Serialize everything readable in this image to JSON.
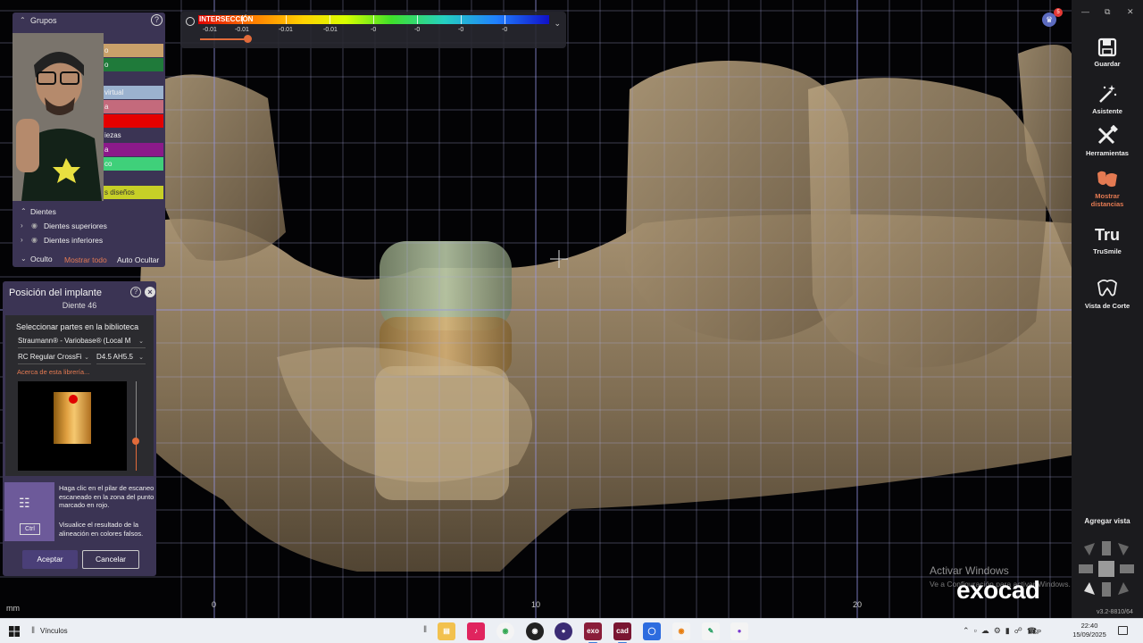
{
  "intersection": {
    "title": "INTERSECCIÓN",
    "values": [
      "-0.01",
      "-0.01",
      "-0.01",
      "-0.01",
      "-0",
      "-0",
      "-0",
      "-0"
    ]
  },
  "groups": {
    "title": "Grupos",
    "help": "?",
    "items": [
      {
        "label": "o",
        "color": "#c9a06a"
      },
      {
        "label": "o",
        "color": "#1f7a3a"
      },
      {
        "label": "virtual",
        "color": "#9bb2cf"
      },
      {
        "label": "a",
        "color": "#c46a7c"
      },
      {
        "label": "",
        "color": "#e50000"
      },
      {
        "label": "iezas",
        "color": "#3b3454"
      },
      {
        "label": "a",
        "color": "#8c1a8a"
      },
      {
        "label": "co",
        "color": "#3fd07a"
      },
      {
        "label": "s diseños",
        "color": "#c7cf27"
      }
    ],
    "teeth_section": "Dientes",
    "upper_teeth": "Dientes superiores",
    "lower_teeth": "Dientes inferiores",
    "hidden_section": "Oculto",
    "show_all": "Mostrar todo",
    "auto_hide": "Auto Ocultar"
  },
  "implant": {
    "title": "Posición del implante",
    "tooth": "Diente 46",
    "library_label": "Seleccionar partes en la biblioteca",
    "library_value": "Straumann® - Variobase® (Local M",
    "connection_value": "RC Regular CrossFi",
    "size_value": "D4.5 AH5.5",
    "about_library": "Acerca de esta librería...",
    "ctrl_key": "Ctrl",
    "hint_1": "Haga clic en el pilar de escaneo escaneado en la zona del punto marcado en rojo.",
    "hint_2": "Visualice el resultado de la alineación en colores falsos.",
    "accept": "Aceptar",
    "cancel": "Cancelar",
    "slider_level": 0.33
  },
  "toolbar": {
    "save": "Guardar",
    "assistant": "Asistente",
    "tools": "Herramientas",
    "distances_1": "Mostrar",
    "distances_2": "distancias",
    "trusmile_icon": "Tru",
    "trusmile": "TruSmile",
    "cut_view": "Vista de Corte",
    "add_view": "Agregar vista",
    "version": "v3.2-8810/64"
  },
  "viewport": {
    "unit": "mm",
    "axis_labels": [
      "0",
      "10",
      "20"
    ],
    "notification_count": "5",
    "activate_1": "Activar Windows",
    "activate_2": "Ve a Configuración para activar Windows.",
    "logo": "exocad"
  },
  "taskbar": {
    "links": "Vínculos",
    "language": "ESP",
    "time": "22:40",
    "date": "15/09/2025"
  },
  "colors": {
    "panel": "#3b3454",
    "accent": "#e47a52",
    "toolbar": "#1b1b1e"
  }
}
